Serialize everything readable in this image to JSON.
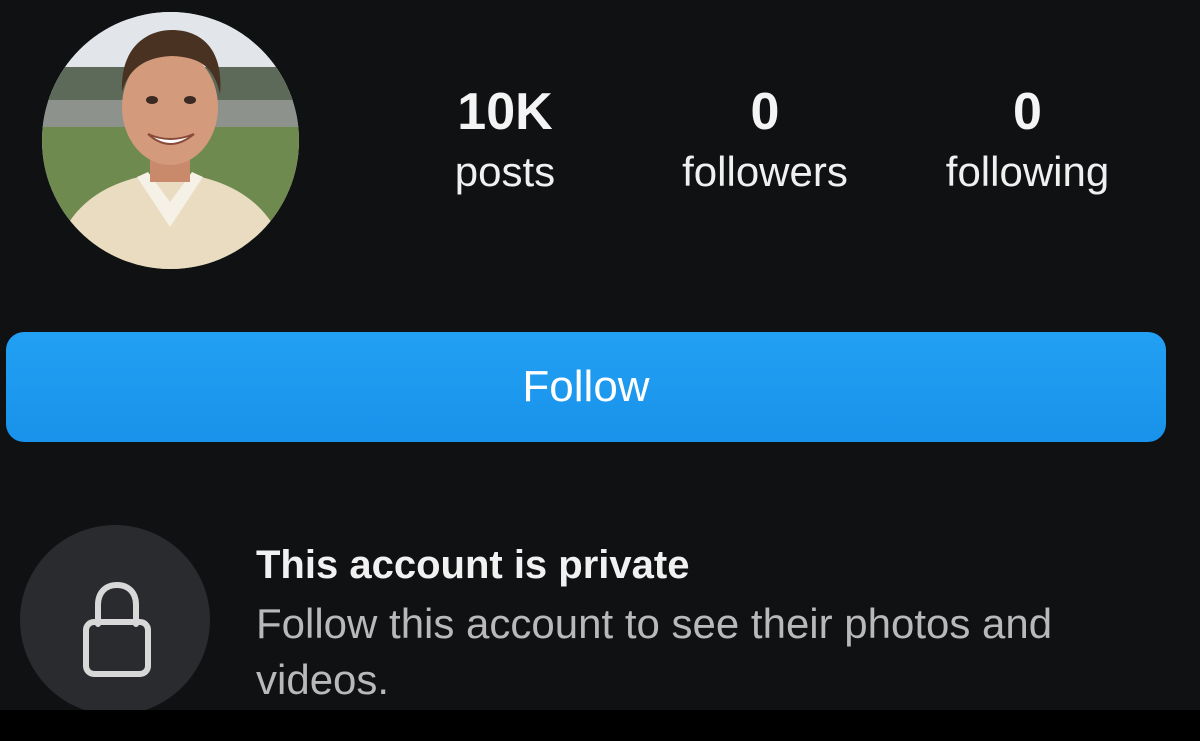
{
  "profile": {
    "avatar_icon": "profile-photo",
    "stats": {
      "posts": {
        "value": "10K",
        "label": "posts"
      },
      "followers": {
        "value": "0",
        "label": "followers"
      },
      "following": {
        "value": "0",
        "label": "following"
      }
    }
  },
  "actions": {
    "follow_label": "Follow",
    "follow_color": "#1d9bf0"
  },
  "private_notice": {
    "icon": "lock-icon",
    "title": "This account is private",
    "description": "Follow this account to see their photos and videos."
  }
}
